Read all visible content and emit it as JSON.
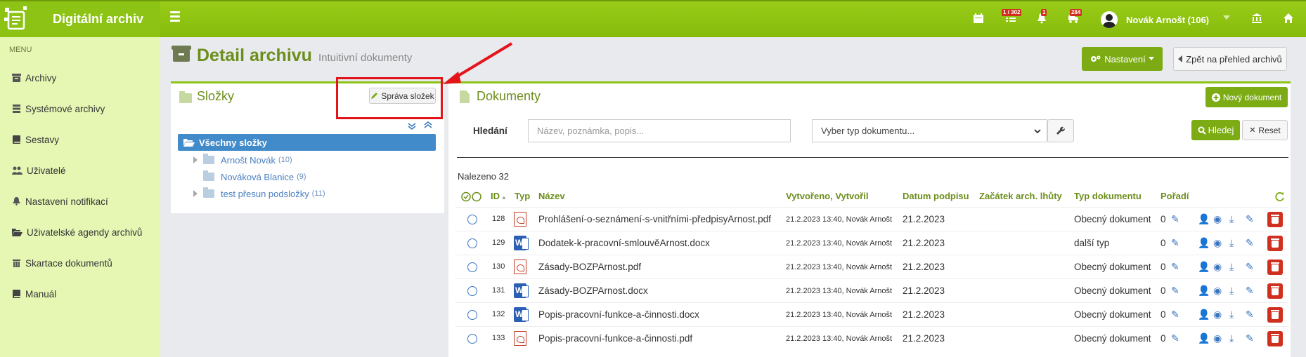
{
  "app": {
    "title": "Digitální archiv"
  },
  "topbar": {
    "badges": {
      "tasks": "1 / 302",
      "notifications": "1",
      "transfers": "284"
    },
    "user_name": "Novák Arnošt (106)"
  },
  "sidebar": {
    "heading": "MENU",
    "items": [
      {
        "label": "Archivy",
        "icon": "archive-icon"
      },
      {
        "label": "Systémové archivy",
        "icon": "database-icon"
      },
      {
        "label": "Sestavy",
        "icon": "book-icon"
      },
      {
        "label": "Uživatelé",
        "icon": "users-icon"
      },
      {
        "label": "Nastavení notifikací",
        "icon": "bell-icon"
      },
      {
        "label": "Uživatelské agendy archivů",
        "icon": "folder-open-icon"
      },
      {
        "label": "Skartace dokumentů",
        "icon": "trash-icon"
      },
      {
        "label": "Manuál",
        "icon": "book-icon"
      }
    ]
  },
  "page": {
    "title": "Detail archivu",
    "subtitle": "Intuitivní dokumenty",
    "settings_button": "Nastavení",
    "back_button": "Zpět na přehled archivů"
  },
  "folders": {
    "title": "Složky",
    "manage_button": "Správa složek",
    "all_label": "Všechny složky",
    "items": [
      {
        "name": "Arnošt Novák",
        "count": "(10)",
        "expandable": true
      },
      {
        "name": "Nováková Blanice",
        "count": "(9)",
        "expandable": false
      },
      {
        "name": "test přesun podsložky",
        "count": "(11)",
        "expandable": true
      }
    ]
  },
  "documents": {
    "title": "Dokumenty",
    "new_button": "Nový dokument",
    "search_label": "Hledání",
    "search_placeholder": "Název, poznámka, popis...",
    "type_select": "Vyber typ dokumentu...",
    "search_button": "Hledej",
    "reset_button": "Reset",
    "found": "Nalezeno 32",
    "columns": [
      "ID",
      "Typ",
      "Název",
      "Vytvořeno, Vytvořil",
      "Datum podpisu",
      "Začátek arch. lhůty",
      "Typ dokumentu",
      "Pořadí"
    ],
    "rows": [
      {
        "id": "128",
        "type": "pdf",
        "name": "Prohlášení-o-seznámení-s-vnitřními-předpisyArnost.pdf",
        "created": "21.2.2023 13:40, Novák Arnošt",
        "signed": "21.2.2023",
        "archive_start": "",
        "doc_type": "Obecný dokument",
        "order": "0"
      },
      {
        "id": "129",
        "type": "doc",
        "name": "Dodatek-k-pracovní-smlouvěArnost.docx",
        "created": "21.2.2023 13:40, Novák Arnošt",
        "signed": "21.2.2023",
        "archive_start": "",
        "doc_type": "další typ",
        "order": "0"
      },
      {
        "id": "130",
        "type": "pdf",
        "name": "Zásady-BOZPArnost.pdf",
        "created": "21.2.2023 13:40, Novák Arnošt",
        "signed": "21.2.2023",
        "archive_start": "",
        "doc_type": "Obecný dokument",
        "order": "0"
      },
      {
        "id": "131",
        "type": "doc",
        "name": "Zásady-BOZPArnost.docx",
        "created": "21.2.2023 13:40, Novák Arnošt",
        "signed": "21.2.2023",
        "archive_start": "",
        "doc_type": "Obecný dokument",
        "order": "0"
      },
      {
        "id": "132",
        "type": "doc",
        "name": "Popis-pracovní-funkce-a-činnosti.docx",
        "created": "21.2.2023 13:40, Novák Arnošt",
        "signed": "21.2.2023",
        "archive_start": "",
        "doc_type": "Obecný dokument",
        "order": "0"
      },
      {
        "id": "133",
        "type": "pdf",
        "name": "Popis-pracovní-funkce-a-činnosti.pdf",
        "created": "21.2.2023 13:40, Novák Arnošt",
        "signed": "21.2.2023",
        "archive_start": "",
        "doc_type": "Obecný dokument",
        "order": "0"
      }
    ]
  },
  "colors": {
    "brand": "#8cc314",
    "brand_dark": "#6c8e1b",
    "accent": "#7cab14",
    "highlight": "#e4141b",
    "danger": "#d0301f",
    "link": "#3a76c0"
  }
}
